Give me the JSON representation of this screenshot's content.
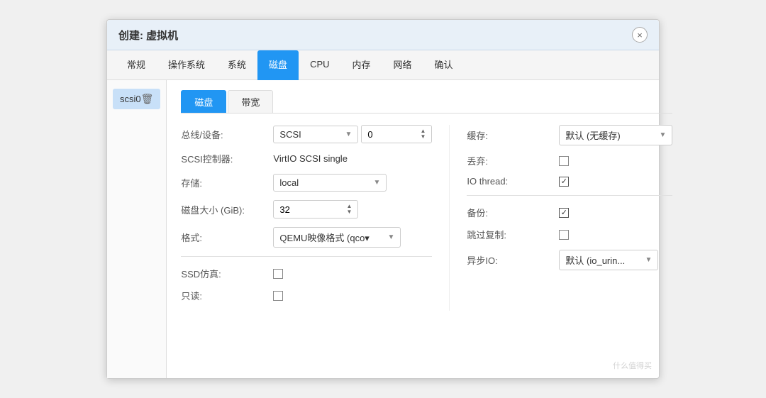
{
  "dialog": {
    "title": "创建: 虚拟机",
    "close_label": "×"
  },
  "tabs": [
    {
      "label": "常规",
      "active": false
    },
    {
      "label": "操作系统",
      "active": false
    },
    {
      "label": "系统",
      "active": false
    },
    {
      "label": "磁盘",
      "active": true
    },
    {
      "label": "CPU",
      "active": false
    },
    {
      "label": "内存",
      "active": false
    },
    {
      "label": "网络",
      "active": false
    },
    {
      "label": "确认",
      "active": false
    }
  ],
  "sidebar": {
    "items": [
      {
        "label": "scsi0"
      }
    ],
    "delete_icon": "🗑"
  },
  "sub_tabs": [
    {
      "label": "磁盘",
      "active": true
    },
    {
      "label": "带宽",
      "active": false
    }
  ],
  "form": {
    "left": {
      "bus_label": "总线/设备:",
      "bus_value": "SCSI",
      "device_num": "0",
      "scsi_label": "SCSI控制器:",
      "scsi_value": "VirtIO SCSI single",
      "storage_label": "存储:",
      "storage_value": "local",
      "disk_size_label": "磁盘大小 (GiB):",
      "disk_size_value": "32",
      "format_label": "格式:",
      "format_value": "QEMU映像格式 (qco▾",
      "ssd_label": "SSD仿真:",
      "readonly_label": "只读:"
    },
    "right": {
      "cache_label": "缓存:",
      "cache_value": "默认 (无缓存)",
      "discard_label": "丢弃:",
      "iothread_label": "IO thread:",
      "backup_label": "备份:",
      "skip_replication_label": "跳过复制:",
      "async_io_label": "异步IO:",
      "async_io_value": "默认 (io_urin..."
    }
  },
  "watermark": "什么值得买"
}
